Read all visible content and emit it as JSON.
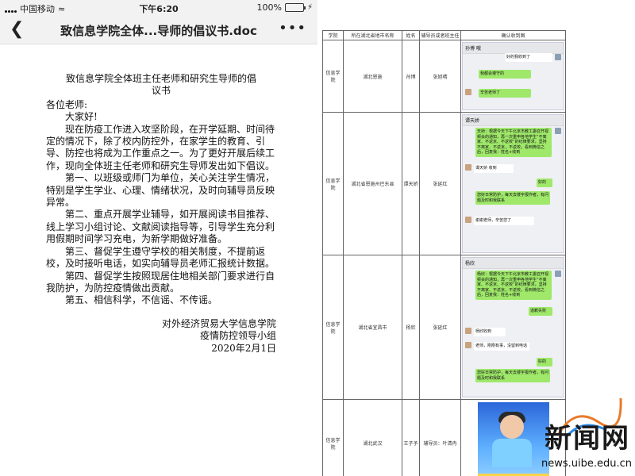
{
  "status_bar": {
    "carrier": "中国移动",
    "time": "下午6:20",
    "battery": "100%",
    "battery_level": 1.0
  },
  "nav": {
    "back_icon": "chevron-left-icon",
    "title": "致信息学院全体...导师的倡议书.doc",
    "more_icon": "more-dots-icon"
  },
  "document": {
    "title_line1": "致信息学院全体班主任老师和研究生导师的倡",
    "title_line2": "议书",
    "salutation": "各位老师:",
    "greeting": "大家好!",
    "paragraphs": [
      "现在防疫工作进入攻坚阶段，在开学延期、时间待定的情况下，除了校内防控外，在家学生的教育、引导、防控也将成为工作重点之一。为了更好开展后续工作，现向全体班主任老师和研究生导师发出如下倡议。",
      "第一、以班级或师门为单位，关心关注学生情况，特别是学生学业、心理、情绪状况，及时向辅导员反映异常。",
      "第二、重点开展学业辅导，如开展阅读书目推荐、线上学习小组讨论、文献阅读指导等，引导学生充分利用假期时间学习充电，为新学期做好准备。",
      "第三、督促学生遵守学校的相关制度，不提前返校，及时接听电话，如实向辅导员老师汇报统计数据。",
      "第四、督促学生按照现居住地相关部门要求进行自我防护，为防控疫情做出贡献。",
      "第五、相信科学，不信谣、不传谣。"
    ],
    "signature_line1": "对外经济贸易大学信息学院",
    "signature_line2": "疫情防控领导小组",
    "date": "2020年2月1日"
  },
  "table": {
    "headers": [
      "学院",
      "所在湖北省地市名称",
      "姓名",
      "辅导员或者班主任",
      "确认收到图"
    ],
    "rows": [
      {
        "college": "信息学院",
        "city": "湖北恩施",
        "name": "孙博",
        "advisor": "张旭晴",
        "chat_header": "孙博 哦",
        "bubbles": [
          "好的我收到了",
          "我都会遵守的",
          "辛苦老师了"
        ]
      },
      {
        "college": "信息学院",
        "city": "湖北省恩施州巴东县",
        "name": "谭天娇",
        "advisor": "张延红",
        "chat_header": "谭天娇",
        "bubbles": [
          "天娇：根据今天下午北京市教工委召开视频会的通知，再一次重申各地学生“不离家、不返京、不返校”的纪律要求，坚持不离家、不返京，不返校，看到微信之后，回复我：姓名+收到",
          "谭天娇 收到",
          "好的",
          "您好日常防护，每天去楼宇报作者，有问题及时和我联系",
          "谢谢老师，辛苦您了"
        ]
      },
      {
        "college": "信息学院",
        "city": "湖北省宜昌市",
        "name": "杨欣",
        "advisor": "张延红",
        "chat_header": "杨欣",
        "bubbles": [
          "杨欣：根据今天下午北京市教工委召开视频会的通知，再一次重申各地学生“不离家、不返京、不返校”的纪律要求，坚持不离家、不返京，不返校，看到微信之后，回复我：姓名+收到",
          "道歉失败",
          "杨欣收到",
          "老师，刚刚有事，没留到电话",
          "好的",
          "您好日常防护，每天去楼宇报作者，有问题及时和我联系"
        ]
      },
      {
        "college": "信息学院",
        "city": "湖北武汉",
        "name": "王子予",
        "advisor": "辅导员：叶清冉",
        "chat_header": "",
        "bubbles": []
      }
    ]
  },
  "watermark": {
    "text": "新闻网",
    "url": "news.uibe.edu.cn"
  },
  "colors": {
    "status_bg": "#f2f2f2",
    "chat_green": "#9fe86a",
    "battery_green": "#4cd964"
  }
}
